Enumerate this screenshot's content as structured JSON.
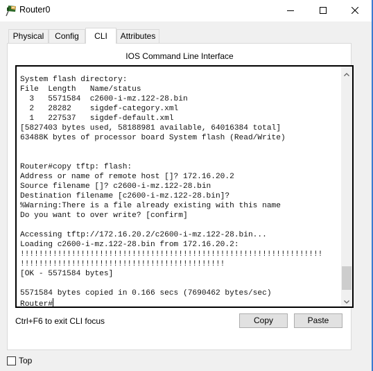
{
  "window": {
    "title": "Router0",
    "app_icon": "router-device-icon",
    "controls": {
      "minimize": "minimize-icon",
      "maximize": "maximize-icon",
      "close": "close-icon"
    },
    "accent_border": "#3b7bd0"
  },
  "tabs": [
    {
      "label": "Physical",
      "active": false
    },
    {
      "label": "Config",
      "active": false
    },
    {
      "label": "CLI",
      "active": true
    },
    {
      "label": "Attributes",
      "active": false
    }
  ],
  "cli": {
    "heading": "IOS Command Line Interface",
    "lines": [
      "System flash directory:",
      "File  Length   Name/status",
      "  3   5571584  c2600-i-mz.122-28.bin",
      "  2   28282    sigdef-category.xml",
      "  1   227537   sigdef-default.xml",
      "[5827403 bytes used, 58188981 available, 64016384 total]",
      "63488K bytes of processor board System flash (Read/Write)",
      "",
      "",
      "Router#copy tftp: flash:",
      "Address or name of remote host []? 172.16.20.2",
      "Source filename []? c2600-i-mz.122-28.bin",
      "Destination filename [c2600-i-mz.122-28.bin]?",
      "%Warning:There is a file already existing with this name",
      "Do you want to over write? [confirm]",
      "",
      "Accessing tftp://172.16.20.2/c2600-i-mz.122-28.bin...",
      "Loading c2600-i-mz.122-28.bin from 172.16.20.2:",
      "!!!!!!!!!!!!!!!!!!!!!!!!!!!!!!!!!!!!!!!!!!!!!!!!!!!!!!!!!!!!!!!!!",
      "!!!!!!!!!!!!!!!!!!!!!!!!!!!!!!!!!!!!!!!!!!!!",
      "[OK - 5571584 bytes]",
      "",
      "5571584 bytes copied in 0.166 secs (7690462 bytes/sec)"
    ],
    "prompt": "Router#",
    "scroll_position": 1.0
  },
  "footer": {
    "hint": "Ctrl+F6 to exit CLI focus",
    "copy_label": "Copy",
    "paste_label": "Paste"
  },
  "top_checkbox": {
    "label": "Top",
    "checked": false
  }
}
